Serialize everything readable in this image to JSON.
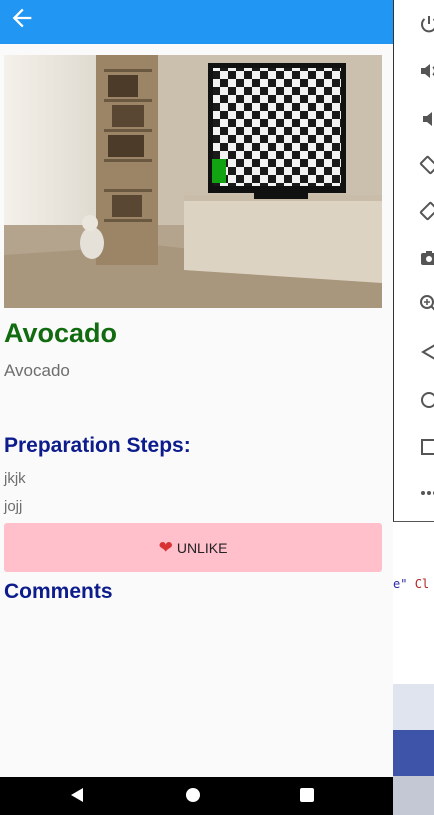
{
  "app_bar": {
    "back_icon": "arrow-left-icon",
    "color": "#2196f3"
  },
  "recipe": {
    "title": "Avocado",
    "subtitle": "Avocado",
    "steps_heading": "Preparation Steps:",
    "steps": [
      "jkjk",
      "jojj"
    ],
    "unlike_label": "UNLIKE",
    "unlike_icon": "heart-icon",
    "comments_heading": "Comments"
  },
  "colors": {
    "title": "#116b10",
    "heading": "#0d1c8c",
    "unlike_bg": "#ffc0cb"
  },
  "nav_bar": {
    "icons": [
      "nav-back-icon",
      "nav-home-icon",
      "nav-recents-icon"
    ]
  },
  "emulator_panel": {
    "tools": [
      "power-icon",
      "volume-up-icon",
      "volume-down-icon",
      "rotate-left-icon",
      "rotate-right-icon",
      "camera-icon",
      "zoom-icon",
      "back-icon",
      "home-icon",
      "overview-icon",
      "more-icon"
    ],
    "code_snippet_string": "e\"",
    "code_snippet_keyword": "Cl"
  }
}
